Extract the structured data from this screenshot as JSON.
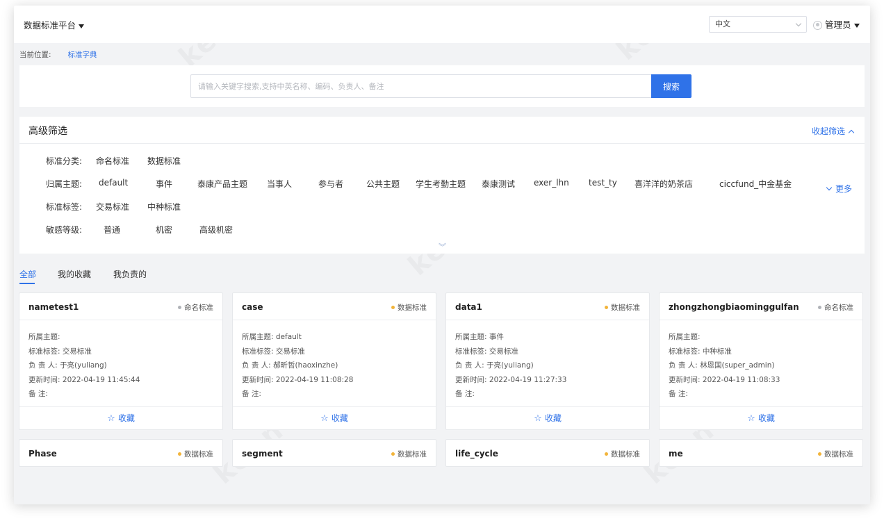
{
  "header": {
    "platform_label": "数据标准平台",
    "language": "中文",
    "user_label": "管理员"
  },
  "breadcrumb": {
    "prefix": "当前位置:",
    "current": "标准字典"
  },
  "search": {
    "placeholder": "请输入关键字搜索,支持中英名称、编码、负责人、备注",
    "button_label": "搜索"
  },
  "filter": {
    "title": "高级筛选",
    "collapse_label": "收起筛选",
    "more_label": "更多",
    "rows": [
      {
        "label": "标准分类:",
        "options": [
          "命名标准",
          "数据标准"
        ]
      },
      {
        "label": "归属主题:",
        "options": [
          "default",
          "事件",
          "泰康产品主题",
          "当事人",
          "参与者",
          "公共主题",
          "学生考勤主题",
          "泰康测试",
          "exer_lhn",
          "test_ty",
          "喜洋洋的奶茶店",
          "ciccfund_中金基金"
        ]
      },
      {
        "label": "标准标签:",
        "options": [
          "交易标准",
          "中种标准"
        ]
      },
      {
        "label": "敏感等级:",
        "options": [
          "普通",
          "机密",
          "高级机密"
        ]
      }
    ]
  },
  "tabs": [
    "全部",
    "我的收藏",
    "我负责的"
  ],
  "card_field_labels": {
    "theme": "所属主题:",
    "tag": "标准标签:",
    "owner": "负 责 人:",
    "updated": "更新时间:",
    "remark": "备    注:"
  },
  "favorite_label": "收藏",
  "cards": [
    {
      "name": "nametest1",
      "type": "命名标准",
      "theme": "",
      "tag": "交易标准",
      "owner": "于亮(yuliang)",
      "updated": "2022-04-19 11:45:44",
      "remark": ""
    },
    {
      "name": "case",
      "type": "数据标准",
      "theme": "default",
      "tag": "交易标准",
      "owner": "郝昕哲(haoxinzhe)",
      "updated": "2022-04-19 11:08:28",
      "remark": ""
    },
    {
      "name": "data1",
      "type": "数据标准",
      "theme": "事件",
      "tag": "交易标准",
      "owner": "于亮(yuliang)",
      "updated": "2022-04-19 11:27:33",
      "remark": ""
    },
    {
      "name": "zhongzhongbiaominggulfan",
      "type": "命名标准",
      "theme": "",
      "tag": "中种标准",
      "owner": "林恩国(super_admin)",
      "updated": "2022-04-19 11:08:33",
      "remark": ""
    },
    {
      "name": "Phase",
      "type": "数据标准"
    },
    {
      "name": "segment",
      "type": "数据标准"
    },
    {
      "name": "life_cycle",
      "type": "数据标准"
    },
    {
      "name": "me",
      "type": "数据标准"
    }
  ],
  "colors": {
    "accent": "#2f72e8",
    "naming_dot": "#b0b3b8",
    "data_dot": "#f2b43a"
  }
}
